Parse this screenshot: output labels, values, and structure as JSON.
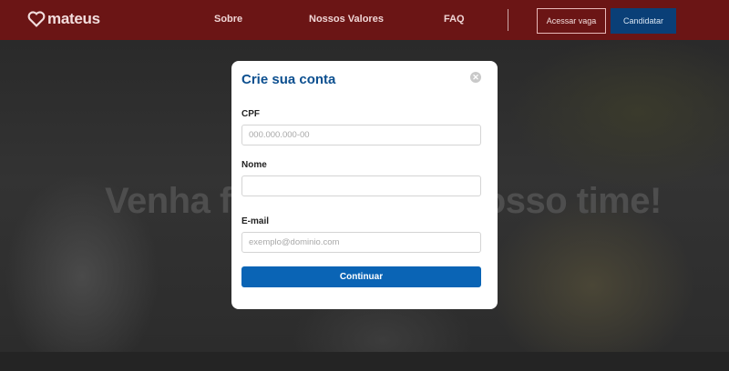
{
  "header": {
    "logo_text": "mateus",
    "nav": [
      "Sobre",
      "Nossos Valores",
      "FAQ"
    ],
    "btn_outline_label": "Acessar vaga",
    "btn_blue_label": "Candidatar"
  },
  "hero": {
    "title": "Venha fazer parte do nosso time!"
  },
  "modal": {
    "title": "Crie sua conta",
    "close_label": "✕",
    "fields": [
      {
        "label": "CPF",
        "placeholder": "000.000.000-00",
        "value": ""
      },
      {
        "label": "Nome",
        "placeholder": "",
        "value": ""
      },
      {
        "label": "E-mail",
        "placeholder": "exemplo@dominio.com",
        "value": ""
      }
    ],
    "submit_label": "Continuar"
  },
  "colors": {
    "header_bg": "#6b1515",
    "modal_title": "#0c4f8f",
    "submit_bg": "#0a64b5"
  }
}
